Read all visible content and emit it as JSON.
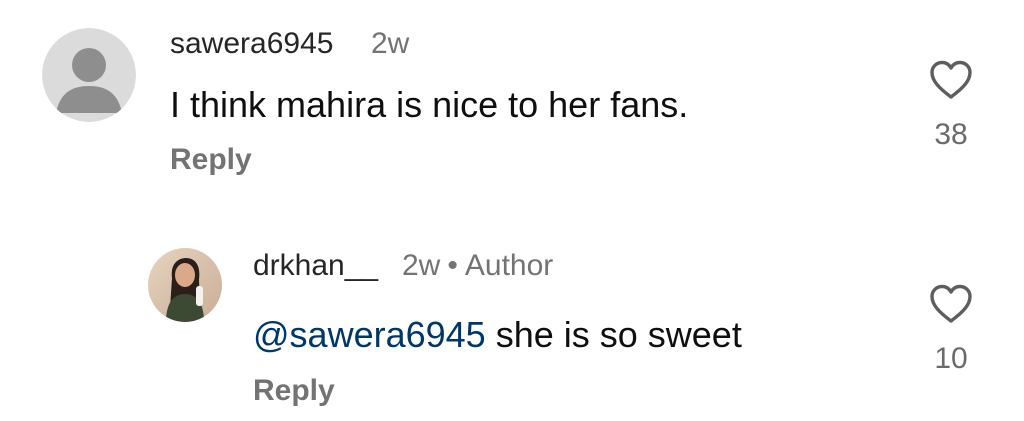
{
  "comments": [
    {
      "username": "sawera6945",
      "time": "2w",
      "author_badge": "",
      "text": "I think mahira is nice to her fans.",
      "reply_label": "Reply",
      "like_count": "38",
      "avatar_icon": "default-user-avatar-icon",
      "heart_icon": "heart-outline-icon"
    },
    {
      "username": "drkhan__",
      "time": "2w",
      "author_badge": "Author",
      "mention": "@sawera6945",
      "text": "she is so sweet",
      "reply_label": "Reply",
      "like_count": "10",
      "avatar_icon": "profile-photo",
      "heart_icon": "heart-outline-icon"
    }
  ],
  "colors": {
    "username": "#262626",
    "meta": "#737373",
    "mention": "#00376b",
    "avatar_bg": "#dbdbdb",
    "avatar_fg": "#8e8e8e"
  }
}
